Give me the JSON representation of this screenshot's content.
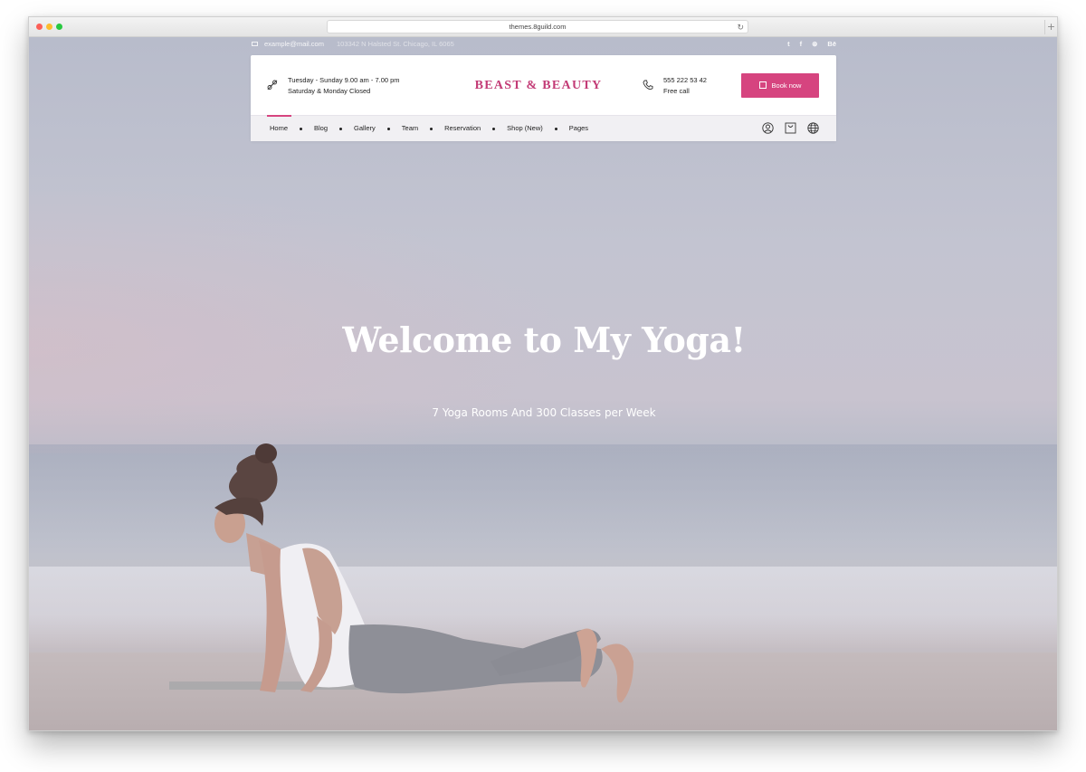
{
  "browser": {
    "url": "themes.8guild.com",
    "new_tab": "+",
    "reload": "↻"
  },
  "topbar": {
    "email": "example@mail.com",
    "address": "103342 N Halsted St. Chicago, IL 6065",
    "social": [
      "twitter-icon",
      "facebook-icon",
      "dribbble-icon",
      "behance-icon"
    ],
    "social_labels": {
      "twitter": "t",
      "facebook": "f",
      "dribbble": "⊛",
      "behance": "Bē"
    }
  },
  "header": {
    "hours_line1": "Tuesday - Sunday 9.00 am - 7.00 pm",
    "hours_line2": "Saturday & Monday Closed",
    "logo": "BEAST & BEAUTY",
    "phone": "555 222 53 42",
    "phone_note": "Free call",
    "book_label": "Book now"
  },
  "nav": {
    "items": [
      "Home",
      "Blog",
      "Gallery",
      "Team",
      "Reservation",
      "Shop (New)",
      "Pages"
    ],
    "icons": [
      "account-icon",
      "cart-icon",
      "globe-icon"
    ]
  },
  "hero": {
    "title": "Welcome to My Yoga!",
    "subtitle": "7 Yoga Rooms And 300 Classes per Week"
  },
  "colors": {
    "brand": "#c33b76",
    "button": "#d6447f"
  }
}
